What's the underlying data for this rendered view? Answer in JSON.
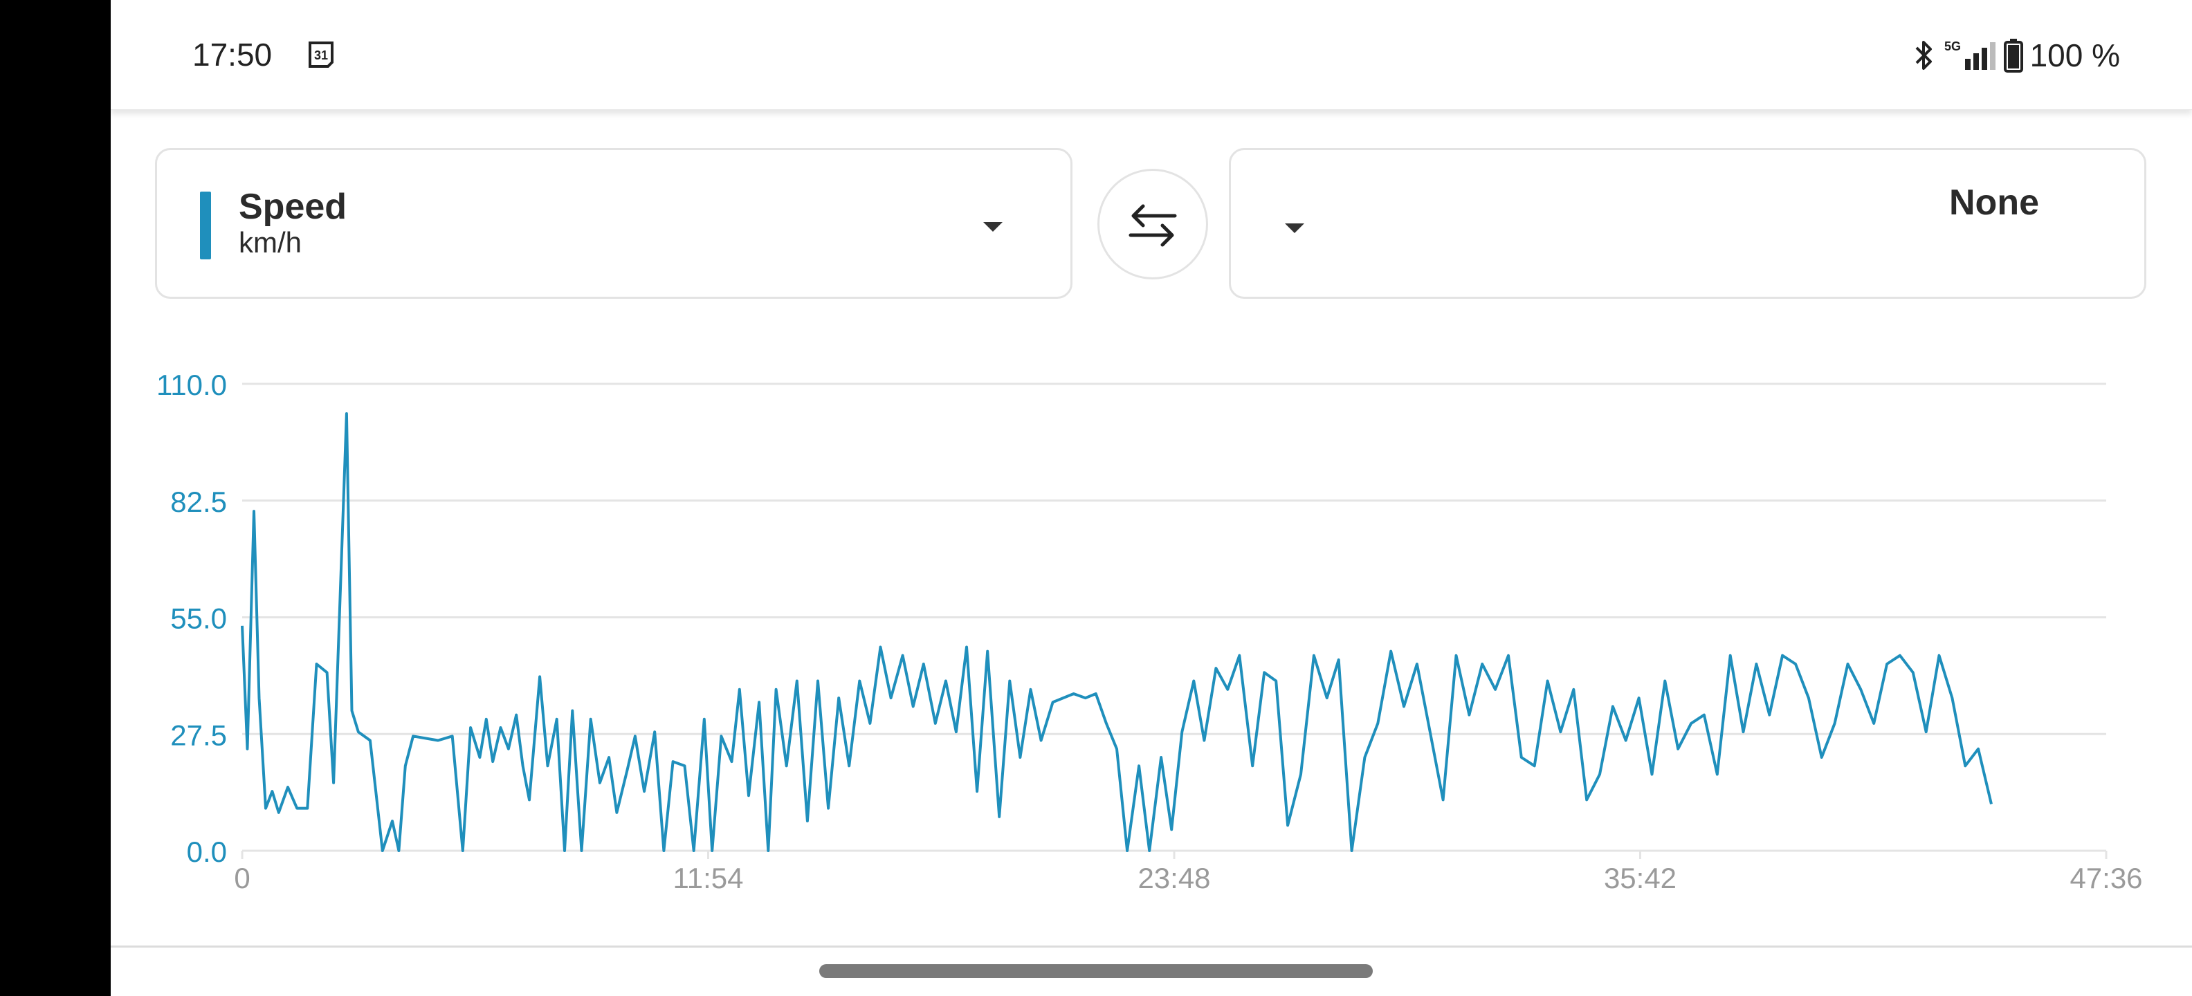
{
  "status_bar": {
    "time": "17:50",
    "calendar_day": "31",
    "network": "5G",
    "battery": "100 %",
    "icons": [
      "calendar-icon",
      "bluetooth-icon",
      "signal-5g-icon",
      "battery-icon"
    ]
  },
  "left_selector": {
    "title": "Speed",
    "unit": "km/h",
    "accent_color": "#1f8fbc",
    "dropdown_icon": "caret-down-icon"
  },
  "swap_button": {
    "icon": "swap-arrows-icon"
  },
  "right_selector": {
    "selected_value": "None",
    "dropdown_icon": "caret-down-icon"
  },
  "chart_data": {
    "type": "line",
    "title": "",
    "xlabel": "",
    "ylabel": "",
    "line_color": "#1f8fbc",
    "grid": true,
    "ylim": [
      0,
      110
    ],
    "xlim_seconds": [
      0,
      2856
    ],
    "y_ticks": [
      "0.0",
      "27.5",
      "55.0",
      "82.5",
      "110.0"
    ],
    "x_ticks": [
      "0",
      "11:54",
      "23:48",
      "35:42",
      "47:36"
    ],
    "series": [
      {
        "x_seconds": [
          0,
          8,
          18,
          26,
          36,
          46,
          56,
          70,
          84,
          100,
          114,
          130,
          140,
          160,
          168,
          178,
          196,
          215,
          230,
          240,
          250,
          262,
          300,
          322,
          338,
          350,
          364,
          374,
          384,
          396,
          408,
          420,
          430,
          440,
          456,
          468,
          482,
          494,
          506,
          520,
          534,
          548,
          562,
          574,
          590,
          602,
          616,
          632,
          646,
          660,
          678,
          692,
          708,
          720,
          734,
          750,
          762,
          776,
          792,
          806,
          818,
          834,
          850,
          866,
          882,
          898,
          914,
          930,
          946,
          962,
          978,
          994,
          1012,
          1028,
          1044,
          1062,
          1078,
          1094,
          1110,
          1126,
          1142,
          1160,
          1176,
          1192,
          1208,
          1224,
          1242,
          1258,
          1274,
          1292,
          1308,
          1324,
          1340,
          1356,
          1374,
          1390,
          1408,
          1424,
          1440,
          1458,
          1474,
          1492,
          1510,
          1528,
          1548,
          1566,
          1584,
          1602,
          1622,
          1642,
          1662,
          1680,
          1700,
          1720,
          1740,
          1760,
          1780,
          1800,
          1820,
          1840,
          1860,
          1880,
          1900,
          1920,
          1940,
          1960,
          1980,
          2000,
          2020,
          2040,
          2060,
          2080,
          2100,
          2120,
          2140,
          2160,
          2180,
          2200,
          2220,
          2240,
          2260,
          2280,
          2300,
          2320,
          2340,
          2360,
          2380,
          2400,
          2420,
          2440,
          2460,
          2480,
          2500,
          2520,
          2540,
          2560,
          2580,
          2600,
          2620,
          2640,
          2660,
          2680,
          2700,
          2720,
          2740,
          2760,
          2780,
          2800,
          2820,
          2840,
          2856
        ],
        "y_kmh": [
          53,
          24,
          80,
          36,
          10,
          14,
          9,
          15,
          10,
          10,
          44,
          42,
          16,
          103,
          33,
          28,
          26,
          0,
          7,
          0,
          20,
          27,
          26,
          27,
          0,
          29,
          22,
          31,
          21,
          29,
          24,
          32,
          20,
          12,
          41,
          20,
          31,
          0,
          33,
          0,
          31,
          16,
          22,
          9,
          19,
          27,
          14,
          28,
          0,
          21,
          20,
          0,
          31,
          0,
          27,
          21,
          38,
          13,
          35,
          0,
          38,
          20,
          40,
          7,
          40,
          10,
          36,
          20,
          40,
          30,
          48,
          36,
          46,
          34,
          44,
          30,
          40,
          28,
          48,
          14,
          47,
          8,
          40,
          22,
          38,
          26,
          35,
          36,
          37,
          36,
          37,
          30,
          24,
          0,
          20,
          0,
          22,
          5,
          28,
          40,
          26,
          43,
          38,
          46,
          20,
          42,
          40,
          6,
          18,
          46,
          36,
          45,
          0,
          22,
          30,
          47,
          34,
          44,
          28,
          12,
          46,
          32,
          44,
          38,
          46,
          22,
          20,
          40,
          28,
          38,
          12,
          18,
          34,
          26,
          36,
          18,
          40,
          24,
          30,
          32,
          18,
          46,
          28,
          44,
          32,
          46,
          44,
          36,
          22,
          30,
          44,
          38,
          30,
          44,
          46,
          42,
          28,
          46,
          36,
          20,
          24,
          11
        ],
        "value_units": "km/h"
      }
    ]
  }
}
